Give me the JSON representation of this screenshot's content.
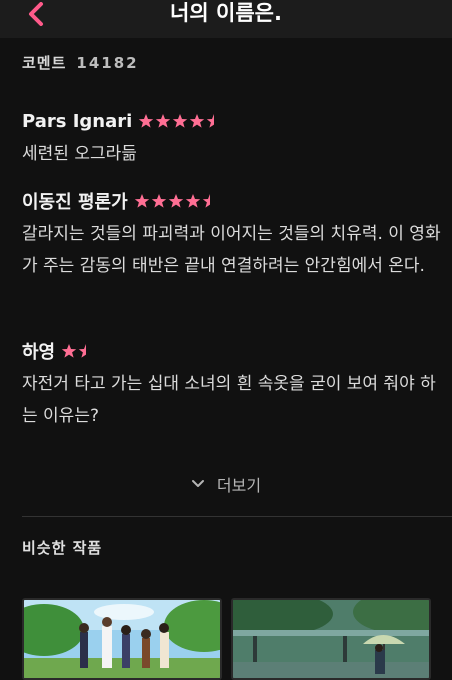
{
  "header": {
    "title": "너의 이름은."
  },
  "comments": {
    "label": "코멘트",
    "count": "14182",
    "more_label": "더보기"
  },
  "reviews": [
    {
      "author": "Pars Ignari",
      "rating": 4.5,
      "text": "세련된 오그라듦"
    },
    {
      "author": "이동진 평론가",
      "rating": 4.5,
      "text": "갈라지는 것들의 파괴력과 이어지는 것들의 치유력. 이 영화가 주는 감동의 태반은 끝내 연결하려는 안간힘에서 온다."
    },
    {
      "author": "하영",
      "rating": 1.5,
      "text": "자전거 타고 가는 십대 소녀의 흰 속옷을 굳이 보여 줘야 하는 이유는?"
    }
  ],
  "similar": {
    "title": "비슷한 작품"
  },
  "colors": {
    "accent": "#ff5a8a",
    "star": "#ff6f94"
  }
}
